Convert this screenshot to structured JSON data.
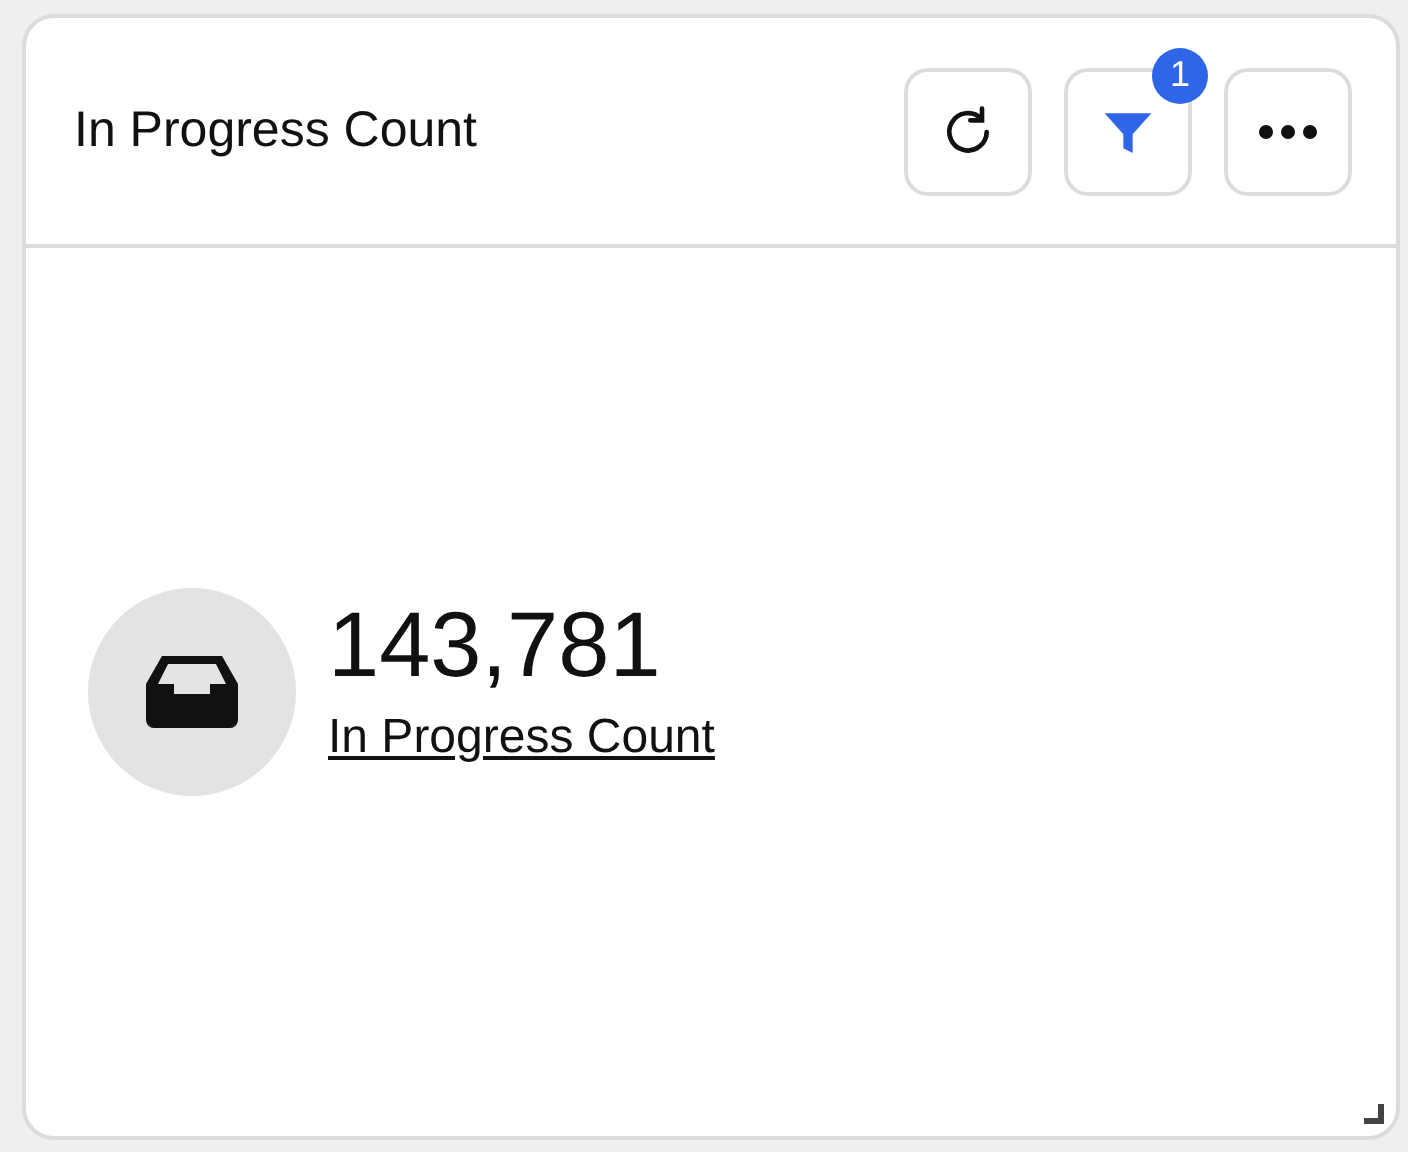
{
  "card": {
    "title": "In Progress Count",
    "toolbar": [
      {
        "kind": "refresh"
      },
      {
        "kind": "filter",
        "badge": "1"
      },
      {
        "kind": "more"
      }
    ],
    "metric": {
      "value": "143,781",
      "link": "In Progress Count"
    }
  }
}
